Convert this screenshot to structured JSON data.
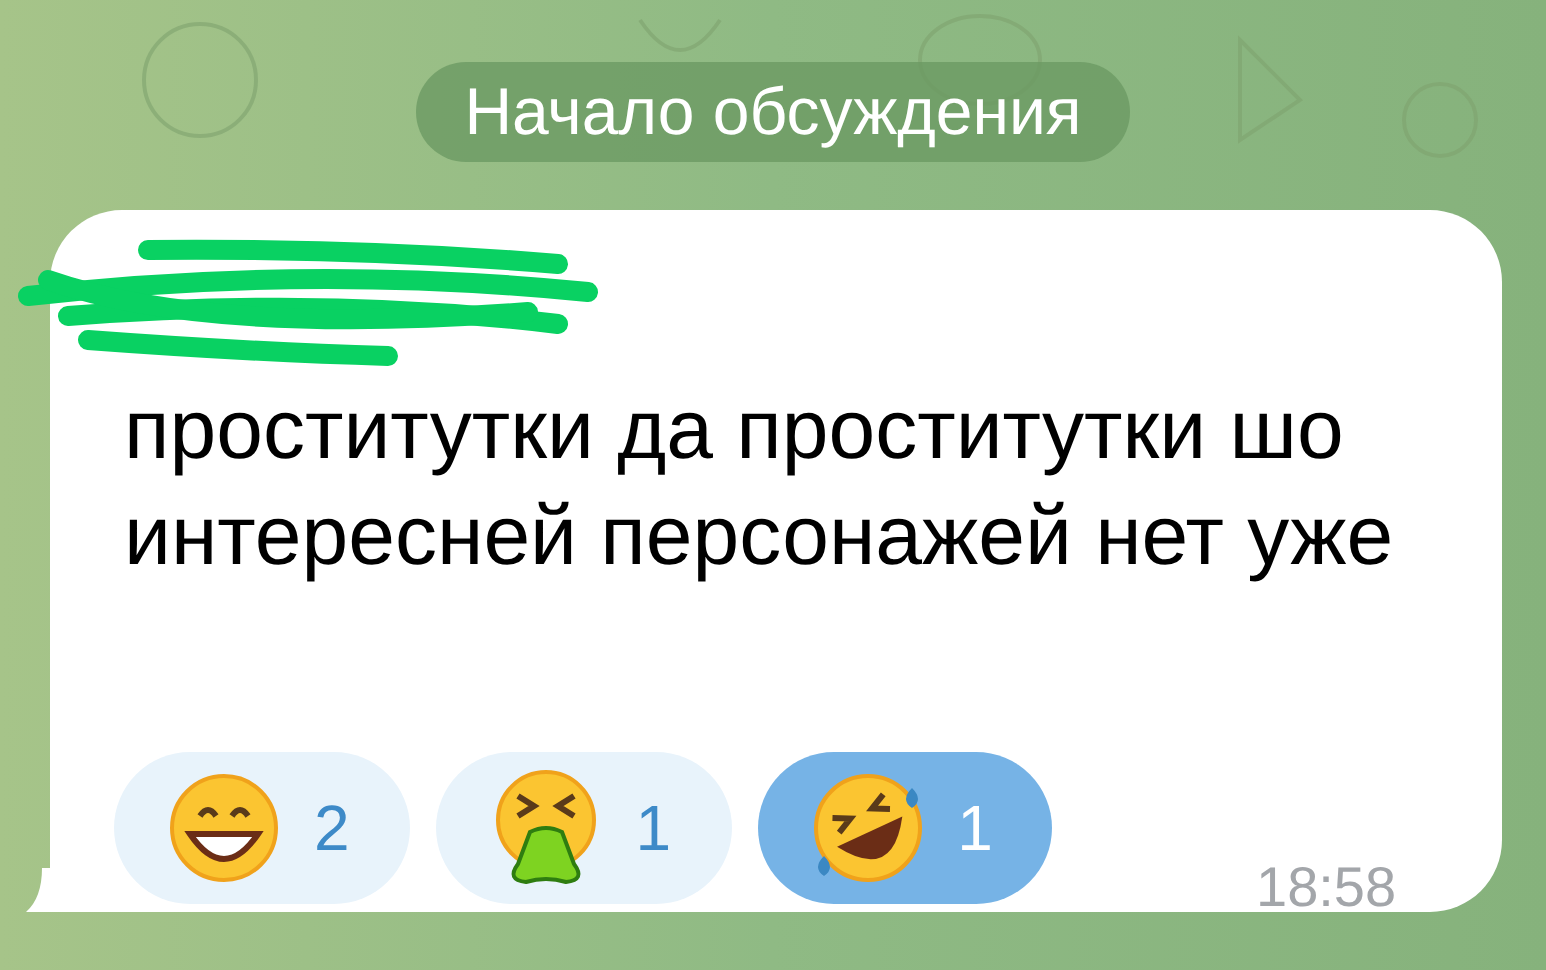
{
  "service_message": "Начало обсуждения",
  "message": {
    "text": "проститутки да проститутки шо интересней персонажей нет уже",
    "time": "18:58",
    "reactions": [
      {
        "kind": "grin",
        "count": "2",
        "selected": false
      },
      {
        "kind": "vomit",
        "count": "1",
        "selected": false
      },
      {
        "kind": "rofl",
        "count": "1",
        "selected": true
      }
    ]
  }
}
